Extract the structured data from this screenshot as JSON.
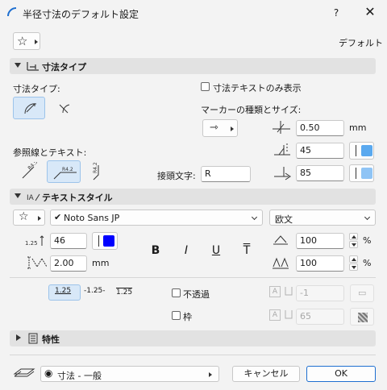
{
  "window": {
    "title": "半径寸法のデフォルト設定",
    "help": "?",
    "close": "✕"
  },
  "header": {
    "favorites_label": "☆",
    "default_label": "デフォルト"
  },
  "sections": {
    "dim_type": "寸法タイプ",
    "text_style": "テキストスタイル",
    "properties": "特性"
  },
  "dim_type": {
    "label": "寸法タイプ:",
    "text_only_label": "寸法テキストのみ表示",
    "marker_label": "マーカーの種類とサイズ:",
    "marker_size": "0.50",
    "marker_unit": "mm",
    "angle_value": "45",
    "pen_value": "85",
    "ref_label": "参照線とテキスト:",
    "prefix_label": "接頭文字:",
    "prefix_value": "R",
    "ref_icon1": "R4.5",
    "ref_icon2": "R4.2",
    "ref_icon3": "R4.2"
  },
  "text_style": {
    "font": "Noto Sans JP",
    "script": "欧文",
    "font_size": "46",
    "spacing": "2.00",
    "spacing_unit": "mm",
    "bold": "B",
    "italic": "I",
    "underline": "U",
    "strike": "T",
    "width_pct": "100",
    "spacing_pct": "100",
    "pct": "%",
    "fmt1": "1.25",
    "fmt2": "-1.25-",
    "fmt3": "1.25",
    "opaque_label": "不透過",
    "frame_label": "枠",
    "opaque_value": "-1",
    "frame_value": "65",
    "size_icon_label": "1.25"
  },
  "footer": {
    "layer": "寸法 - 一般",
    "cancel": "キャンセル",
    "ok": "OK"
  },
  "colors": {
    "accent": "#1e90ff",
    "blue": "#0000ff",
    "light_blue": "#5aa9ef"
  }
}
